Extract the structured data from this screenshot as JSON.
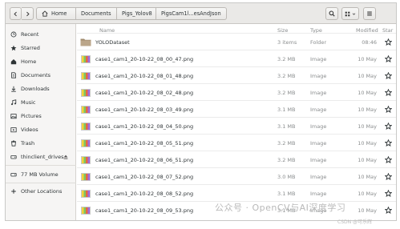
{
  "toolbar": {
    "back_icon": "chevron-left-icon",
    "forward_icon": "chevron-right-icon",
    "search_icon": "search-icon",
    "view_icon": "grid-icon",
    "menu_icon": "hamburger-icon"
  },
  "breadcrumb": [
    {
      "label": "Home"
    },
    {
      "label": "Documents"
    },
    {
      "label": "Pigs_Yolov8"
    },
    {
      "label": "PigsCam1l...esAndJson"
    }
  ],
  "sidebar": {
    "items": [
      {
        "label": "Recent"
      },
      {
        "label": "Starred"
      },
      {
        "label": "Home"
      },
      {
        "label": "Documents"
      },
      {
        "label": "Downloads"
      },
      {
        "label": "Music"
      },
      {
        "label": "Pictures"
      },
      {
        "label": "Videos"
      },
      {
        "label": "Trash"
      },
      {
        "label": "thinclient_drives"
      },
      {
        "label": "77 MB Volume"
      },
      {
        "label": "Other Locations"
      }
    ]
  },
  "columns": {
    "name": "Name",
    "size": "Size",
    "type": "Type",
    "modified": "Modified",
    "star": "Star"
  },
  "files": [
    {
      "name": "YOLODataset",
      "size": "3 items",
      "type": "Folder",
      "modified": "08:46"
    },
    {
      "name": "case1_cam1_20-10-22_08_00_47.png",
      "size": "3.2 MB",
      "type": "Image",
      "modified": "10 May"
    },
    {
      "name": "case1_cam1_20-10-22_08_01_48.png",
      "size": "3.2 MB",
      "type": "Image",
      "modified": "10 May"
    },
    {
      "name": "case1_cam1_20-10-22_08_02_48.png",
      "size": "3.2 MB",
      "type": "Image",
      "modified": "10 May"
    },
    {
      "name": "case1_cam1_20-10-22_08_03_49.png",
      "size": "3.1 MB",
      "type": "Image",
      "modified": "10 May"
    },
    {
      "name": "case1_cam1_20-10-22_08_04_50.png",
      "size": "3.1 MB",
      "type": "Image",
      "modified": "10 May"
    },
    {
      "name": "case1_cam1_20-10-22_08_05_51.png",
      "size": "3.2 MB",
      "type": "Image",
      "modified": "10 May"
    },
    {
      "name": "case1_cam1_20-10-22_08_06_51.png",
      "size": "3.2 MB",
      "type": "Image",
      "modified": "10 May"
    },
    {
      "name": "case1_cam1_20-10-22_08_07_52.png",
      "size": "3.0 MB",
      "type": "Image",
      "modified": "10 May"
    },
    {
      "name": "case1_cam1_20-10-22_08_08_52.png",
      "size": "3.1 MB",
      "type": "Image",
      "modified": "10 May"
    },
    {
      "name": "case1_cam1_20-10-22_08_09_53.png",
      "size": "3.1 MB",
      "type": "Image",
      "modified": "10 May"
    }
  ],
  "watermark": {
    "text": "公众号 · OpenCV与AI深度学习",
    "sub": "CSDN @可乐辉"
  },
  "colors": {
    "folder": "#a08b6d",
    "header_bg": "#eae9e7",
    "sidebar_bg": "#f6f5f4"
  }
}
